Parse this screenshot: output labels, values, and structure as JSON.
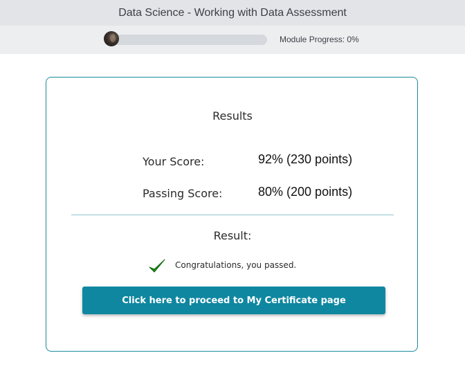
{
  "header": {
    "title": "Data Science - Working with Data Assessment"
  },
  "progress": {
    "label": "Module Progress: 0%",
    "value_percent": 0,
    "avatar_icon": "user-avatar"
  },
  "results": {
    "title": "Results",
    "your_score_label": "Your Score:",
    "your_score_value": "92% (230 points)",
    "passing_score_label": "Passing Score:",
    "passing_score_value": "80% (200 points)",
    "result_heading": "Result:",
    "result_icon": "checkmark-icon",
    "result_message": "Congratulations, you passed.",
    "certificate_button_label": "Click here to proceed to My Certificate page"
  },
  "colors": {
    "accent": "#0f87a1",
    "card_border": "#1a8a9a",
    "check": "#1f8a1f",
    "header_bg": "#e2e4e7"
  }
}
